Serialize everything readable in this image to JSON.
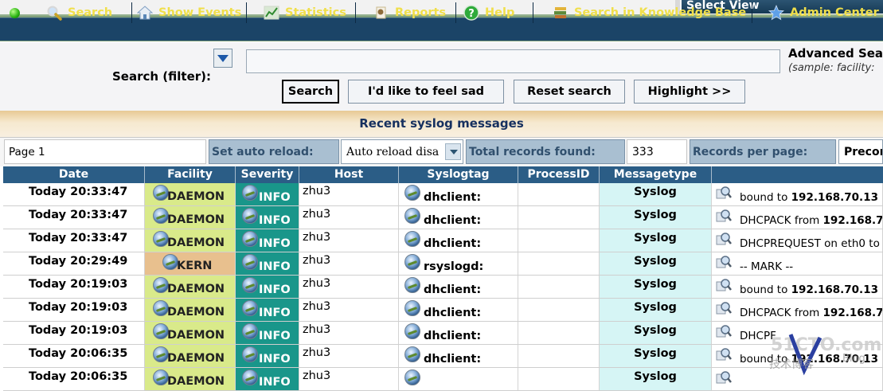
{
  "topbar": {
    "select_view": "Select View"
  },
  "menu": [
    {
      "label": "Search",
      "icon": "magnifier-icon"
    },
    {
      "label": "Show Events",
      "icon": "house-icon"
    },
    {
      "label": "Statistics",
      "icon": "chart-icon"
    },
    {
      "label": "Reports",
      "icon": "report-icon"
    },
    {
      "label": "Help",
      "icon": "help-icon"
    },
    {
      "label": "Search in Knowledge Base",
      "icon": "books-icon"
    },
    {
      "label": "Admin Center",
      "icon": "star-icon"
    }
  ],
  "filter": {
    "label": "Search (filter):",
    "input_value": "",
    "advanced_title": "Advanced Sear",
    "advanced_sample": "(sample: facility:",
    "buttons": {
      "search": "Search",
      "feel_sad": "I'd like to feel sad",
      "reset": "Reset search",
      "highlight": "Highlight >>"
    }
  },
  "recent_title": "Recent syslog messages",
  "pager": {
    "page_label": "Page 1",
    "auto_reload_label": "Set auto reload:",
    "auto_reload_value": "Auto reload disa",
    "total_label": "Total records found:",
    "total_value": "333",
    "per_page_label": "Records per page:",
    "per_page_value": "Precon"
  },
  "grid": {
    "columns": [
      "Date",
      "Facility",
      "Severity",
      "Host",
      "Syslogtag",
      "ProcessID",
      "Messagetype",
      ""
    ],
    "rows": [
      {
        "date": "Today 20:33:47",
        "facility": "DAEMON",
        "severity": "INFO",
        "host": "zhu3",
        "tag": "dhclient:",
        "pid": "",
        "mtype": "Syslog",
        "msg_plain": "bound to ",
        "msg_bold": "192.168.70.13"
      },
      {
        "date": "Today 20:33:47",
        "facility": "DAEMON",
        "severity": "INFO",
        "host": "zhu3",
        "tag": "dhclient:",
        "pid": "",
        "mtype": "Syslog",
        "msg_plain": "DHCPACK from ",
        "msg_bold": "192.168.7"
      },
      {
        "date": "Today 20:33:47",
        "facility": "DAEMON",
        "severity": "INFO",
        "host": "zhu3",
        "tag": "dhclient:",
        "pid": "",
        "mtype": "Syslog",
        "msg_plain": "DHCPREQUEST on eth0 to",
        "msg_bold": ""
      },
      {
        "date": "Today 20:29:49",
        "facility": "KERN",
        "severity": "INFO",
        "host": "zhu3",
        "tag": "rsyslogd:",
        "pid": "",
        "mtype": "Syslog",
        "msg_plain": "-- MARK --",
        "msg_bold": ""
      },
      {
        "date": "Today 20:19:03",
        "facility": "DAEMON",
        "severity": "INFO",
        "host": "zhu3",
        "tag": "dhclient:",
        "pid": "",
        "mtype": "Syslog",
        "msg_plain": "bound to ",
        "msg_bold": "192.168.70.13"
      },
      {
        "date": "Today 20:19:03",
        "facility": "DAEMON",
        "severity": "INFO",
        "host": "zhu3",
        "tag": "dhclient:",
        "pid": "",
        "mtype": "Syslog",
        "msg_plain": "DHCPACK from ",
        "msg_bold": "192.168.7"
      },
      {
        "date": "Today 20:19:03",
        "facility": "DAEMON",
        "severity": "INFO",
        "host": "zhu3",
        "tag": "dhclient:",
        "pid": "",
        "mtype": "Syslog",
        "msg_plain": "DHCPF",
        "msg_bold": ""
      },
      {
        "date": "Today 20:06:35",
        "facility": "DAEMON",
        "severity": "INFO",
        "host": "zhu3",
        "tag": "dhclient:",
        "pid": "",
        "mtype": "Syslog",
        "msg_plain": "bound to ",
        "msg_bold": "192.168.70.13"
      },
      {
        "date": "Today 20:06:35",
        "facility": "DAEMON",
        "severity": "INFO",
        "host": "zhu3",
        "tag": "",
        "pid": "",
        "mtype": "Syslog",
        "msg_plain": "",
        "msg_bold": ""
      }
    ]
  },
  "watermark": {
    "line1": "51CTO.com",
    "line2": "技术博客",
    "line3": "Blog"
  }
}
